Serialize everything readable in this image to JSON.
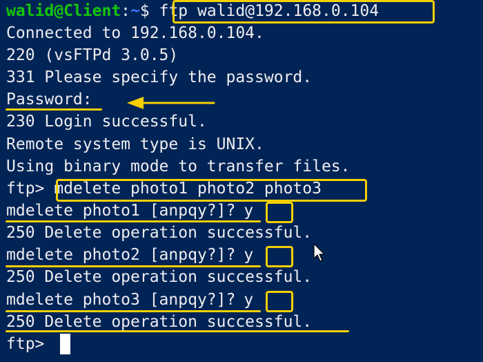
{
  "terminal": {
    "prompt": {
      "user_host": "walid@Client",
      "separator": ":",
      "path": "~",
      "dollar": "$",
      "command": "ftp walid@192.168.0.104"
    },
    "lines": [
      "Connected to 192.168.0.104.",
      "220 (vsFTPd 3.0.5)",
      "331 Please specify the password.",
      "Password:",
      "230 Login successful.",
      "Remote system type is UNIX.",
      "Using binary mode to transfer files."
    ],
    "ftp_prompt": "ftp>",
    "mdelete_command": "mdelete photo1 photo2 photo3",
    "confirmations": [
      {
        "question": "mdelete photo1 [anpqy?]?",
        "answer": "y",
        "result": "250 Delete operation successful."
      },
      {
        "question": "mdelete photo2 [anpqy?]?",
        "answer": "y",
        "result": "250 Delete operation successful."
      },
      {
        "question": "mdelete photo3 [anpqy?]?",
        "answer": "y",
        "result": "250 Delete operation successful."
      }
    ],
    "final_prompt": "ftp>"
  },
  "colors": {
    "background": "#012456",
    "text": "#eeedf0",
    "user_host": "#16c60c",
    "path": "#3b78ff",
    "highlight": "#f5d000"
  },
  "icons": [
    "arrow-left-icon",
    "mouse-pointer-icon",
    "text-cursor"
  ]
}
